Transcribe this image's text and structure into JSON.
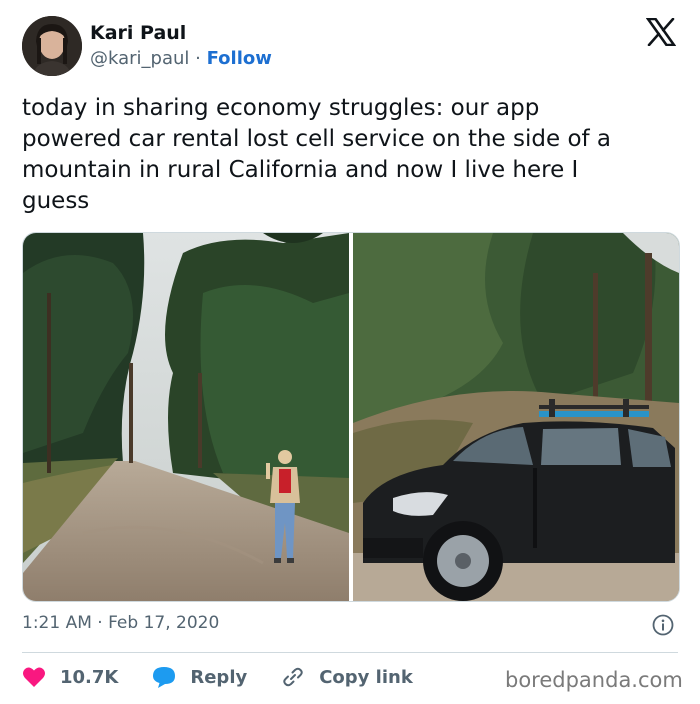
{
  "author": {
    "name": "Kari Paul",
    "handle": "@kari_paul",
    "separator": "·",
    "follow_label": "Follow"
  },
  "platform_icon": "x-logo-icon",
  "tweet": {
    "text": "today in sharing economy struggles: our app\npowered car rental lost cell service on the side of a\nmountain in rural California and now I live here I\nguess"
  },
  "media": {
    "photos": [
      {
        "subject": "woman-on-dirt-road",
        "icon": "photo-icon"
      },
      {
        "subject": "black-car-with-roof-rack",
        "icon": "photo-icon"
      }
    ]
  },
  "meta": {
    "timestamp": "1:21 AM · Feb 17, 2020",
    "info_icon": "info-icon"
  },
  "actions": {
    "like_count": "10.7K",
    "reply_label": "Reply",
    "copy_link_label": "Copy link"
  },
  "colors": {
    "like": "#f91880",
    "reply": "#1d9bf0",
    "follow": "#1d6fd1",
    "muted": "#536471"
  },
  "watermark": "boredpanda.com"
}
